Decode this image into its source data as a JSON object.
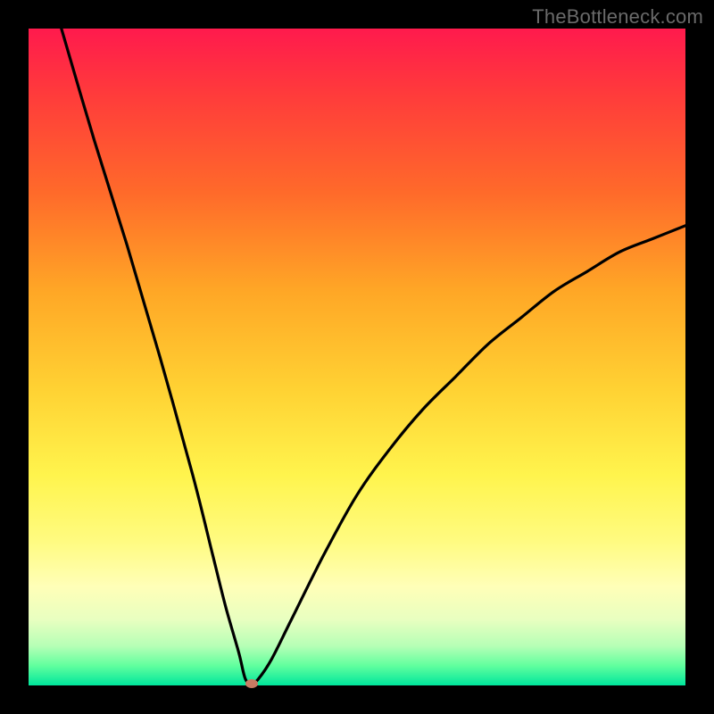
{
  "attribution": "TheBottleneck.com",
  "colors": {
    "frame": "#000000",
    "gradient_top": "#ff1a4d",
    "gradient_bottom": "#00e69c",
    "curve": "#000000",
    "marker": "#c97a63"
  },
  "chart_data": {
    "type": "line",
    "title": "",
    "xlabel": "",
    "ylabel": "",
    "xlim": [
      0,
      100
    ],
    "ylim": [
      0,
      100
    ],
    "series": [
      {
        "name": "bottleneck-curve",
        "x": [
          5,
          10,
          15,
          20,
          25,
          28,
          30,
          32,
          33,
          34,
          35,
          37,
          40,
          45,
          50,
          55,
          60,
          65,
          70,
          75,
          80,
          85,
          90,
          95,
          100
        ],
        "y": [
          100,
          83,
          67,
          50,
          32,
          20,
          12,
          5,
          1,
          0.3,
          1,
          4,
          10,
          20,
          29,
          36,
          42,
          47,
          52,
          56,
          60,
          63,
          66,
          68,
          70
        ]
      }
    ],
    "marker": {
      "x": 34,
      "y": 0.3
    },
    "grid": false
  }
}
